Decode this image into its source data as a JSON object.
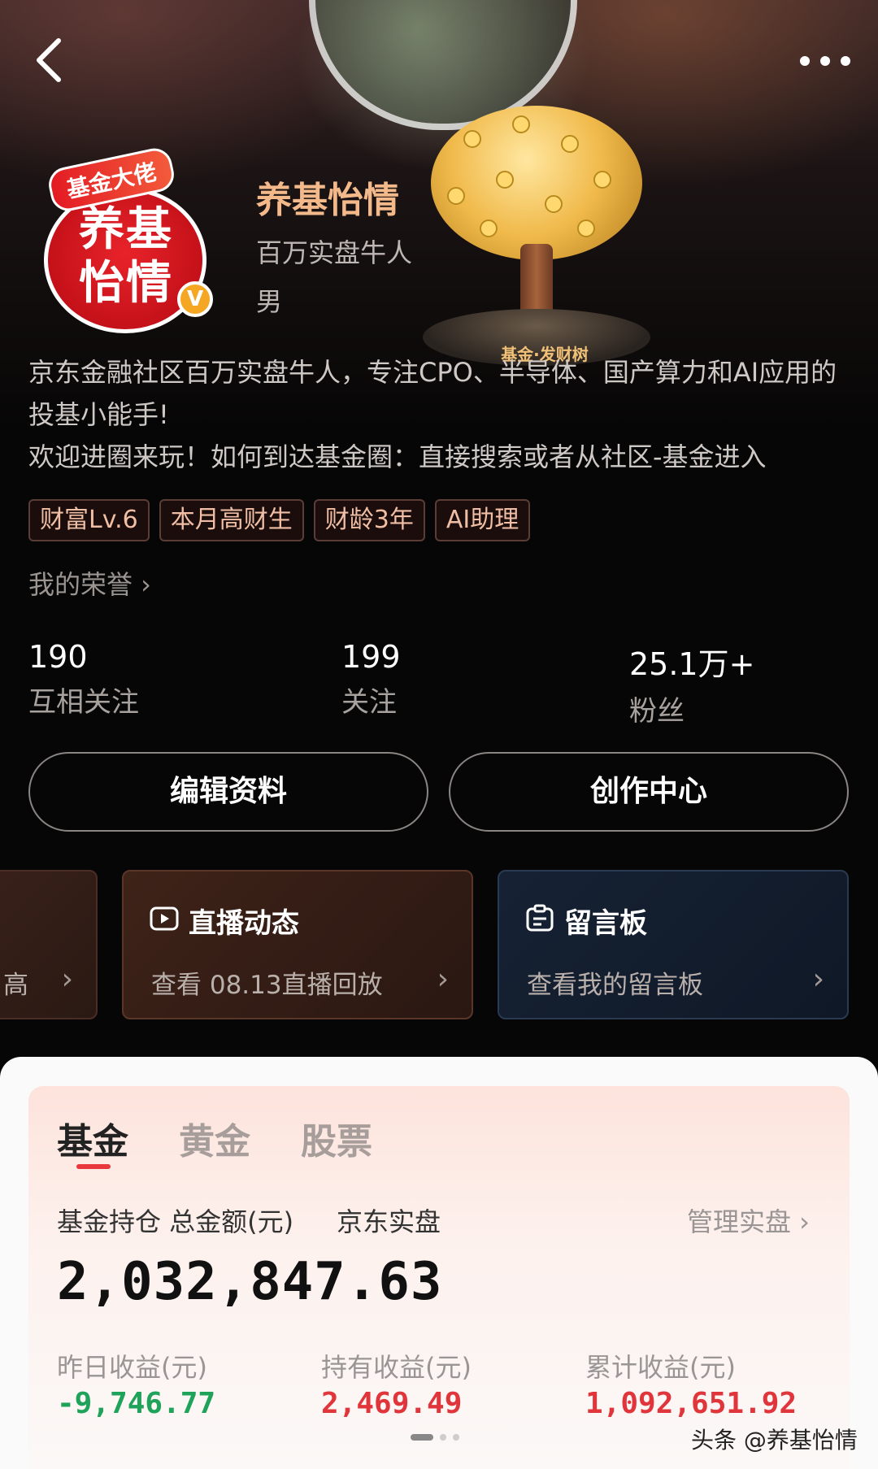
{
  "header": {
    "back_icon": "chevron-left-icon",
    "more_icon": "more-dots-icon"
  },
  "profile": {
    "avatar_ribbon": "基金大佬",
    "avatar_text": "养基怡情",
    "verified_badge": "V",
    "username": "养基怡情",
    "subtitle": "百万实盘牛人",
    "gender": "男",
    "decoration_label": "基金·发财树",
    "bio": "京东金融社区百万实盘牛人，专注CPO、半导体、国产算力和AI应用的投基小能手!\n欢迎进圈来玩！如何到达基金圈：直接搜索或者从社区-基金进入",
    "tags": [
      "财富Lv.6",
      "本月高财生",
      "财龄3年",
      "AI助理"
    ],
    "honor_link": "我的荣誉 ›"
  },
  "stats": [
    {
      "value": "190",
      "label": "互相关注"
    },
    {
      "value": "199",
      "label": "关注"
    },
    {
      "value": "25.1万+",
      "label": "粉丝"
    }
  ],
  "actions": {
    "edit_profile": "编辑资料",
    "creator_center": "创作中心"
  },
  "cards": [
    {
      "title": "",
      "subtitle": "高",
      "icon": ""
    },
    {
      "title": "直播动态",
      "subtitle": "查看 08.13直播回放",
      "icon": "video-icon"
    },
    {
      "title": "留言板",
      "subtitle": "查看我的留言板",
      "icon": "message-board-icon"
    }
  ],
  "holdings": {
    "tabs": [
      "基金",
      "黄金",
      "股票"
    ],
    "active_tab": "基金",
    "title": "基金持仓 总金额(元)",
    "source": "京东实盘",
    "manage_link": "管理实盘 ›",
    "total": "2,032,847.63",
    "metrics": [
      {
        "label": "昨日收益(元)",
        "value": "-9,746.77",
        "color": "#1fa35a"
      },
      {
        "label": "持有收益(元)",
        "value": "2,469.49",
        "color": "#e0353b"
      },
      {
        "label": "累计收益(元)",
        "value": "1,092,651.92",
        "color": "#e0353b"
      }
    ]
  },
  "watermark": "头条 @养基怡情",
  "colors": {
    "accent_gold": "#f3b98a",
    "tab_active": "#222222",
    "tab_inactive": "#a79d9b",
    "tab_indicator": "#e8383d"
  }
}
